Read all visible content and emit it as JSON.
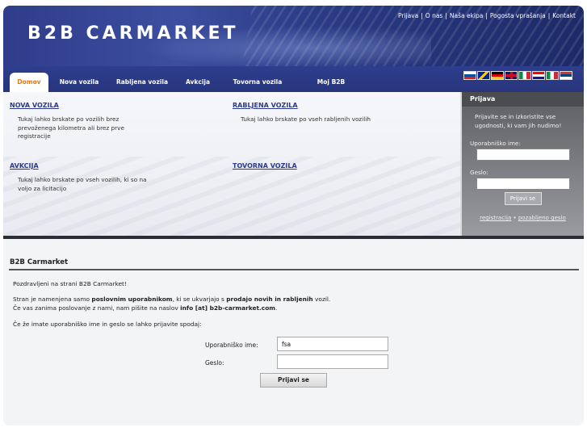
{
  "header": {
    "logo": "B2B CARMARKET",
    "links": [
      "Prijava",
      "O nas",
      "Naša ekipa",
      "Pogosta vprašanja",
      "Kontakt"
    ],
    "separator": "|"
  },
  "nav": {
    "tabs": [
      "Domov",
      "Nova vozila",
      "Rabljena vozila",
      "Avkcija",
      "Tovorna vozila",
      "Moj B2B"
    ],
    "active_tab": "Domov",
    "flags": [
      "slovenia-flag",
      "bosnia-flag",
      "germany-flag",
      "uk-flag",
      "italy-flag",
      "croatia-flag",
      "italy-flag",
      "serbia-flag"
    ]
  },
  "categories": [
    {
      "title": "NOVA VOZILA",
      "desc": "Tukaj lahko brskate po vozilih brez prevoženega kilometra ali brez prve registracije"
    },
    {
      "title": "RABLJENA VOZILA",
      "desc": "Tukaj lahko brskate po vseh rabljenih vozilih"
    },
    {
      "title": "AVKCIJA",
      "desc": "Tukaj lahko brskate po vseh vozilih, ki so na voljo za licitacijo"
    },
    {
      "title": "TOVORNA VOZILA",
      "desc": ""
    }
  ],
  "sidebar": {
    "title": "Prijava",
    "intro": "Prijavite se in izkoristite vse ugodnosti, ki vam jih nudimo!",
    "username_label": "Uporabniško ime:",
    "password_label": "Geslo:",
    "button": "Prijavi se",
    "register_link": "registracija",
    "link_separator": "•",
    "forgot_link": "pozabljeno geslo"
  },
  "main": {
    "title": "B2B Carmarket",
    "greeting": "Pozdravljeni na strani B2B Carmarket!",
    "line1_a": "Stran je namenjena samo ",
    "line1_b": "poslovnim uporabnikom",
    "line1_c": ", ki se ukvarjajo s ",
    "line1_d": "prodajo novih in rabljenih",
    "line1_e": " vozil.",
    "line2_a": "Če vas zanima poslovanje z nami, nam pišite na naslov ",
    "line2_b": "info [at] b2b-carmarket.com",
    "line2_c": ".",
    "line3": "Če že imate uporabniško ime in geslo se lahko prijavite spodaj:",
    "username_label": "Uporabniško ime:",
    "username_value": "fsa",
    "password_label": "Geslo:",
    "password_value": "",
    "button": "Prijavi se"
  },
  "colors": {
    "brand": "#2f3c8a",
    "active_tab_text": "#e07a12",
    "link": "#2d3a8c"
  }
}
